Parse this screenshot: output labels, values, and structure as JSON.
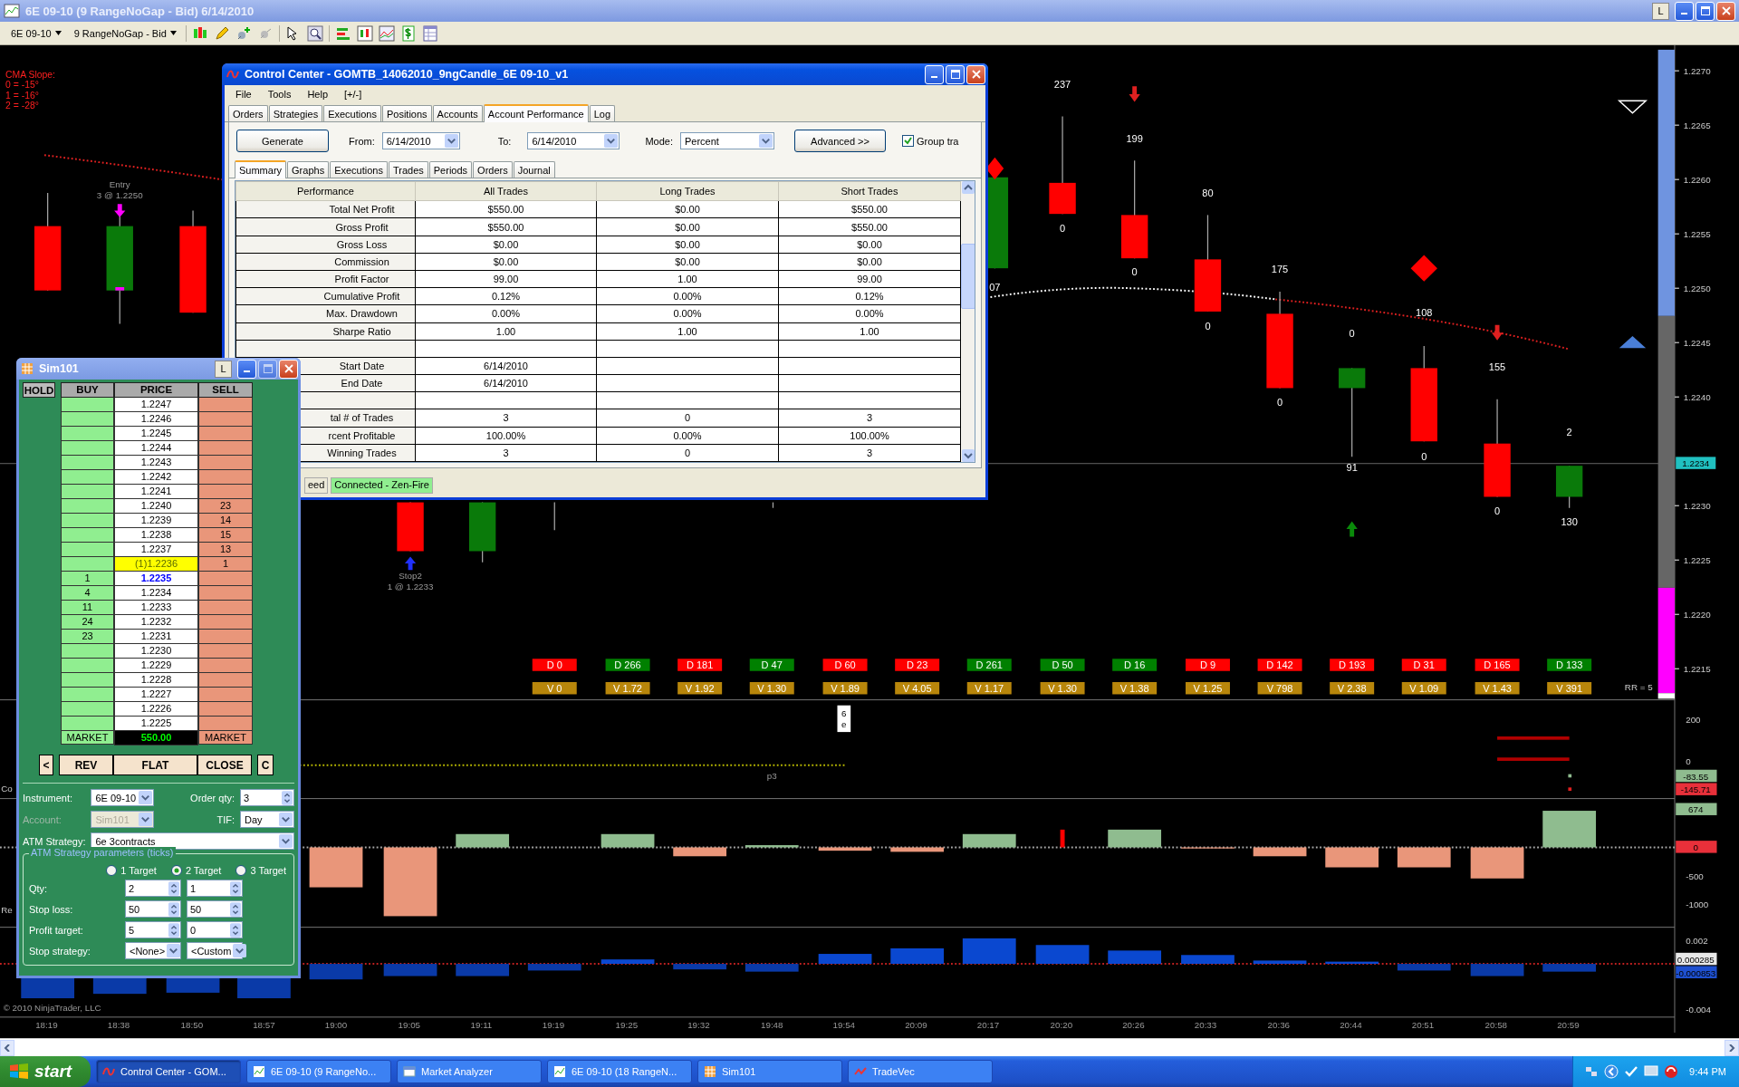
{
  "window": {
    "title": "6E 09-10 (9 RangeNoGap - Bid)  6/14/2010",
    "button": "L"
  },
  "toolbar": {
    "instrument": "6E 09-10",
    "bar_type": "9 RangeNoGap - Bid"
  },
  "chart": {
    "cma_slope": [
      "CMA Slope:",
      "0 = -15°",
      "1 = -16°",
      "2 = -28°"
    ],
    "trade_marks": [
      {
        "kind": "entry",
        "title": "Entry",
        "detail": "3 @ 1.2250"
      },
      {
        "kind": "exit",
        "title": "Stop2",
        "detail": "1 @ 1.2233"
      }
    ],
    "bar_labels": [
      {
        "above": "237",
        "below": "0"
      },
      {
        "above": "199",
        "below": "0"
      },
      {
        "above": "80",
        "below": "0"
      },
      {
        "above": "175",
        "below": "0"
      },
      {
        "above": "0",
        "below": "91"
      },
      {
        "above": "108",
        "below": "0"
      },
      {
        "above": "155",
        "below": "0"
      },
      {
        "above": "2",
        "below": "130"
      }
    ],
    "partial_label": "07",
    "price_ticks": [
      "1.2270",
      "1.2265",
      "1.2260",
      "1.2255",
      "1.2250",
      "1.2245",
      "1.2240",
      "1.2230",
      "1.2225",
      "1.2220",
      "1.2215"
    ],
    "last_price": "1.2234",
    "rr_label": "RR = 5",
    "delta": [
      {
        "text": "D 0",
        "color": "#ff0000"
      },
      {
        "text": "D 266",
        "color": "#008000"
      },
      {
        "text": "D 181",
        "color": "#ff0000"
      },
      {
        "text": "D 47",
        "color": "#008000"
      },
      {
        "text": "D 60",
        "color": "#ff0000"
      },
      {
        "text": "D 23",
        "color": "#ff0000"
      },
      {
        "text": "D 261",
        "color": "#008000"
      },
      {
        "text": "D 50",
        "color": "#008000"
      },
      {
        "text": "D 16",
        "color": "#008000"
      },
      {
        "text": "D 9",
        "color": "#ff0000"
      },
      {
        "text": "D 142",
        "color": "#ff0000"
      },
      {
        "text": "D 193",
        "color": "#ff0000"
      },
      {
        "text": "D 31",
        "color": "#ff0000"
      },
      {
        "text": "D 165",
        "color": "#ff0000"
      },
      {
        "text": "D 133",
        "color": "#008000"
      }
    ],
    "volume": [
      "V 0",
      "V 1.72",
      "V 1.92",
      "V 1.30",
      "V 1.89",
      "V 4.05",
      "V 1.17",
      "V 1.30",
      "V 1.38",
      "V 1.25",
      "V 798",
      "V 2.38",
      "V 1.09",
      "V 1.43",
      "V 391"
    ],
    "panel_1": {
      "ticks": [
        "200",
        "0"
      ],
      "values": [
        {
          "text": "-83.55",
          "color": "#8fbc8f"
        },
        {
          "text": "-145.71",
          "color": "#e8303a"
        }
      ],
      "line_label": "p3",
      "marker": "6e"
    },
    "panel_2": {
      "ticks": [
        "-500",
        "-1000"
      ],
      "values": [
        {
          "text": "674",
          "color": "#8fbc8f"
        },
        {
          "text": "0",
          "color": "#e8303a"
        }
      ]
    },
    "panel_3": {
      "ticks": [
        "0.002",
        "-0.004"
      ],
      "values": [
        {
          "text": "0.000285",
          "color": "#e8e8e8"
        },
        {
          "text": "-0.000853",
          "color": "#1e50d0"
        }
      ]
    },
    "copyright": "© 2010 NinjaTrader, LLC",
    "time_ticks": [
      "18:19",
      "18:38",
      "18:50",
      "18:57",
      "19:00",
      "19:05",
      "19:11",
      "19:19",
      "19:25",
      "19:32",
      "19:48",
      "19:54",
      "20:09",
      "20:17",
      "20:20",
      "20:26",
      "20:33",
      "20:36",
      "20:44",
      "20:51",
      "20:58",
      "20:59"
    ],
    "edge_labels": [
      "Co",
      "Re"
    ]
  },
  "control_center": {
    "title": "Control Center - GOMTB_14062010_9ngCandle_6E 09-10_v1",
    "menu": [
      "File",
      "Tools",
      "Help",
      "[+/-]"
    ],
    "tabs": [
      {
        "label": "Orders",
        "selected": false
      },
      {
        "label": "Strategies",
        "selected": false
      },
      {
        "label": "Executions",
        "selected": false
      },
      {
        "label": "Positions",
        "selected": false
      },
      {
        "label": "Accounts",
        "selected": false
      },
      {
        "label": "Account Performance",
        "selected": true
      },
      {
        "label": "Log",
        "selected": false
      }
    ],
    "generate": "Generate",
    "from": {
      "label": "From:",
      "value": "6/14/2010"
    },
    "to": {
      "label": "To:",
      "value": "6/14/2010"
    },
    "mode": {
      "label": "Mode:",
      "value": "Percent"
    },
    "advanced": "Advanced >>",
    "group": {
      "label": "Group tra",
      "checked": true
    },
    "subtabs": [
      {
        "label": "Summary",
        "selected": true
      },
      {
        "label": "Graphs",
        "selected": false
      },
      {
        "label": "Executions",
        "selected": false
      },
      {
        "label": "Trades",
        "selected": false
      },
      {
        "label": "Periods",
        "selected": false
      },
      {
        "label": "Orders",
        "selected": false
      },
      {
        "label": "Journal",
        "selected": false
      }
    ],
    "table": {
      "columns": [
        "Performance",
        "All Trades",
        "Long Trades",
        "Short Trades"
      ],
      "rows": [
        {
          "kind": "data",
          "cells": [
            "Total Net Profit",
            "$550.00",
            "$0.00",
            "$550.00"
          ]
        },
        {
          "kind": "data",
          "cells": [
            "Gross Profit",
            "$550.00",
            "$0.00",
            "$550.00"
          ]
        },
        {
          "kind": "data",
          "cells": [
            "Gross Loss",
            "$0.00",
            "$0.00",
            "$0.00"
          ]
        },
        {
          "kind": "data",
          "cells": [
            "Commission",
            "$0.00",
            "$0.00",
            "$0.00"
          ]
        },
        {
          "kind": "data",
          "cells": [
            "Profit Factor",
            "99.00",
            "1.00",
            "99.00"
          ]
        },
        {
          "kind": "data",
          "cells": [
            "Cumulative Profit",
            "0.12%",
            "0.00%",
            "0.12%"
          ]
        },
        {
          "kind": "data",
          "cells": [
            "Max. Drawdown",
            "0.00%",
            "0.00%",
            "0.00%"
          ]
        },
        {
          "kind": "data",
          "cells": [
            "Sharpe Ratio",
            "1.00",
            "1.00",
            "1.00"
          ]
        },
        {
          "kind": "blank"
        },
        {
          "kind": "data",
          "cells": [
            "Start Date",
            "6/14/2010"
          ]
        },
        {
          "kind": "data",
          "cells": [
            "End Date",
            "6/14/2010"
          ]
        },
        {
          "kind": "blank"
        },
        {
          "kind": "data",
          "cells": [
            "tal # of Trades",
            "3",
            "0",
            "3"
          ]
        },
        {
          "kind": "data",
          "cells": [
            "rcent Profitable",
            "100.00%",
            "0.00%",
            "100.00%"
          ]
        },
        {
          "kind": "data",
          "cells": [
            "Winning Trades",
            "3",
            "0",
            "3"
          ]
        }
      ]
    },
    "status": [
      {
        "text": "eed",
        "kind": "plain"
      },
      {
        "text": "Connected - Zen-Fire",
        "kind": "connected"
      }
    ]
  },
  "sim": {
    "title": "Sim101",
    "title_button": "L",
    "columns": [
      "HOLD",
      "BUY",
      "PRICE",
      "SELL"
    ],
    "ladder": [
      {
        "price": "1.2247",
        "kind": "plain"
      },
      {
        "price": "1.2246",
        "kind": "plain"
      },
      {
        "price": "1.2245",
        "kind": "plain"
      },
      {
        "price": "1.2244",
        "kind": "plain"
      },
      {
        "price": "1.2243",
        "kind": "plain"
      },
      {
        "price": "1.2242",
        "kind": "plain"
      },
      {
        "price": "1.2241",
        "kind": "plain"
      },
      {
        "price": "1.2240",
        "sell": "23",
        "kind": "plain"
      },
      {
        "price": "1.2239",
        "sell": "14",
        "kind": "plain"
      },
      {
        "price": "1.2238",
        "sell": "15",
        "kind": "plain"
      },
      {
        "price": "1.2237",
        "sell": "13",
        "kind": "plain"
      },
      {
        "price": "(1)1.2236",
        "sell": "1",
        "kind": "position"
      },
      {
        "price": "1.2235",
        "buy": "1",
        "kind": "bid"
      },
      {
        "price": "1.2234",
        "buy": "4",
        "kind": "plain"
      },
      {
        "price": "1.2233",
        "buy": "11",
        "kind": "plain"
      },
      {
        "price": "1.2232",
        "buy": "24",
        "kind": "plain"
      },
      {
        "price": "1.2231",
        "buy": "23",
        "kind": "plain"
      },
      {
        "price": "1.2230",
        "kind": "plain"
      },
      {
        "price": "1.2229",
        "kind": "plain"
      },
      {
        "price": "1.2228",
        "kind": "plain"
      },
      {
        "price": "1.2227",
        "kind": "plain"
      },
      {
        "price": "1.2226",
        "kind": "plain"
      },
      {
        "price": "1.2225",
        "kind": "plain"
      }
    ],
    "footer": [
      "MARKET",
      "550.00",
      "MARKET"
    ],
    "buttons": [
      "<",
      "REV",
      "FLAT",
      "CLOSE",
      "C"
    ],
    "instrument": {
      "label": "Instrument:",
      "value": "6E 09-10"
    },
    "order_qty": {
      "label": "Order qty:",
      "value": "3"
    },
    "account": {
      "label": "Account:",
      "value": "Sim101",
      "disabled": true
    },
    "tif": {
      "label": "TIF:",
      "value": "Day"
    },
    "atm_strategy": {
      "label": "ATM Strategy:",
      "value": "6e 3contracts"
    },
    "atm": {
      "title": "ATM Strategy parameters (ticks)",
      "targets": [
        {
          "label": "1 Target",
          "selected": false
        },
        {
          "label": "2 Target",
          "selected": true
        },
        {
          "label": "3 Target",
          "selected": false
        }
      ],
      "rows": [
        {
          "label": "Qty:",
          "values": [
            "2",
            "1"
          ]
        },
        {
          "label": "Stop loss:",
          "values": [
            "50",
            "50"
          ]
        },
        {
          "label": "Profit target:",
          "values": [
            "5",
            "0"
          ]
        }
      ],
      "stop_strategy": {
        "label": "Stop strategy:",
        "values": [
          "<None>",
          "<Custom"
        ]
      }
    }
  },
  "taskbar": {
    "start": "start",
    "tasks": [
      {
        "label": "Control Center - GOM...",
        "selected": true
      },
      {
        "label": "6E 09-10 (9 RangeNo...",
        "selected": false
      },
      {
        "label": "Market Analyzer",
        "selected": false
      },
      {
        "label": "6E 09-10 (18 RangeN...",
        "selected": false
      },
      {
        "label": "Sim101",
        "selected": false
      },
      {
        "label": "TradeVec",
        "selected": false
      }
    ],
    "clock": "9:44 PM"
  }
}
